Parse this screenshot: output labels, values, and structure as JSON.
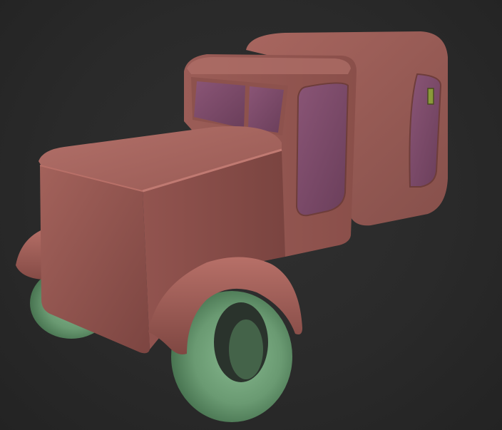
{
  "scene": {
    "background_color": "#2a2a2a",
    "model": {
      "subject": "truck",
      "body_color": "#9a5a55",
      "body_shadow_color": "#6e3d3a",
      "body_highlight_color": "#b87068",
      "window_color": "#7a4a66",
      "wheel_color": "#6a9a72",
      "wheel_shadow_color": "#3f6a48",
      "accent_color": "#8a9a3a"
    }
  }
}
